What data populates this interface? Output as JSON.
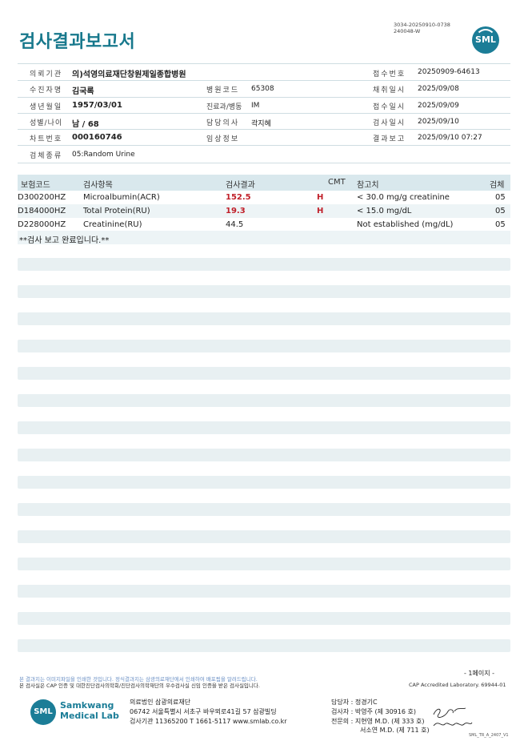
{
  "header": {
    "title": "검사결과보고서",
    "doc_id_line1": "3034-20250910-0738",
    "doc_id_line2": "240048-W",
    "logo_text": "SML"
  },
  "info": {
    "institution_label": "의뢰기관",
    "institution": "의)석영의료재단창원제일종합병원",
    "receipt_no_label": "접수번호",
    "receipt_no": "20250909-64613",
    "patient_label": "수진자명",
    "patient": "김국록",
    "ward_code_label": "병원코드",
    "ward_code": "65308",
    "collect_date_label": "채취일시",
    "collect_date": "2025/09/08",
    "birth_label": "생년월일",
    "birth": "1957/03/01",
    "dept_label": "진료과/병동",
    "dept": "IM",
    "receipt_date_label": "접수일시",
    "receipt_date": "2025/09/09",
    "sex_age_label": "성별/나이",
    "sex_age": "남 / 68",
    "doctor_label": "담당의사",
    "doctor": "곽지혜",
    "test_date_label": "검사일시",
    "test_date": "2025/09/10",
    "chart_no_label": "차트번호",
    "chart_no": "000160746",
    "clinical_label": "임상정보",
    "clinical": "",
    "report_label": "결과보고",
    "report_date": "2025/09/10 07:27",
    "specimen_label": "검체종류",
    "specimen": "05:Random Urine"
  },
  "results": {
    "headers": {
      "code": "보험코드",
      "item": "검사항목",
      "result": "검사결과",
      "cmt": "CMT",
      "reference": "참고치",
      "specimen": "검체"
    },
    "rows": [
      {
        "code": "D300200HZ",
        "item": "Microalbumin(ACR)",
        "result": "152.5",
        "flag": "H",
        "reference": "< 30.0 mg/g creatinine",
        "specimen": "05"
      },
      {
        "code": "D184000HZ",
        "item": "Total Protein(RU)",
        "result": "19.3",
        "flag": "H",
        "reference": "< 15.0 mg/dL",
        "specimen": "05"
      },
      {
        "code": "D228000HZ",
        "item": "Creatinine(RU)",
        "result": "44.5",
        "flag": "",
        "reference": "Not established (mg/dL)",
        "specimen": "05"
      }
    ],
    "complete_note": "**검사 보고 완료입니다.**"
  },
  "footer": {
    "notice1": "본 결과지는 이미지파일을 인쇄한 것입니다. 정식결과지는 삼광의료재단에서 인쇄하여 배포됨을 알려드립니다.",
    "notice2": "본 검사실은 CAP 인증 및 대한진단검사의학회/진단검사의학재단의 우수검사실 신임 인증을 받은 검사실입니다.",
    "page": "- 1페이지 -",
    "cap": "CAP Accredited Laboratory. 69944-01",
    "company_line1": "Samkwang",
    "company_line2": "Medical Lab",
    "foundation": "의료법인 삼광의료재단",
    "address": "06742 서울특별시 서초구 바우뫼로41길 57 삼광빌딩",
    "contact": "검사기관 11365200 T 1661-5117 www.smlab.co.kr",
    "manager": "담당자 : 정경기C",
    "tester": "검사자 : 박영주 (제 30916 호)",
    "specialist1": "전문의 : 지현영 M.D. (제 333 호)",
    "specialist2": "서소연 M.D. (제 711 호)",
    "form_code": "SML_TR_A_2407_V1"
  },
  "colors": {
    "accent": "#17788c",
    "flag_red": "#c0202a",
    "header_bg": "#d9e8ed",
    "stripe_bg": "#e8f0f2"
  }
}
